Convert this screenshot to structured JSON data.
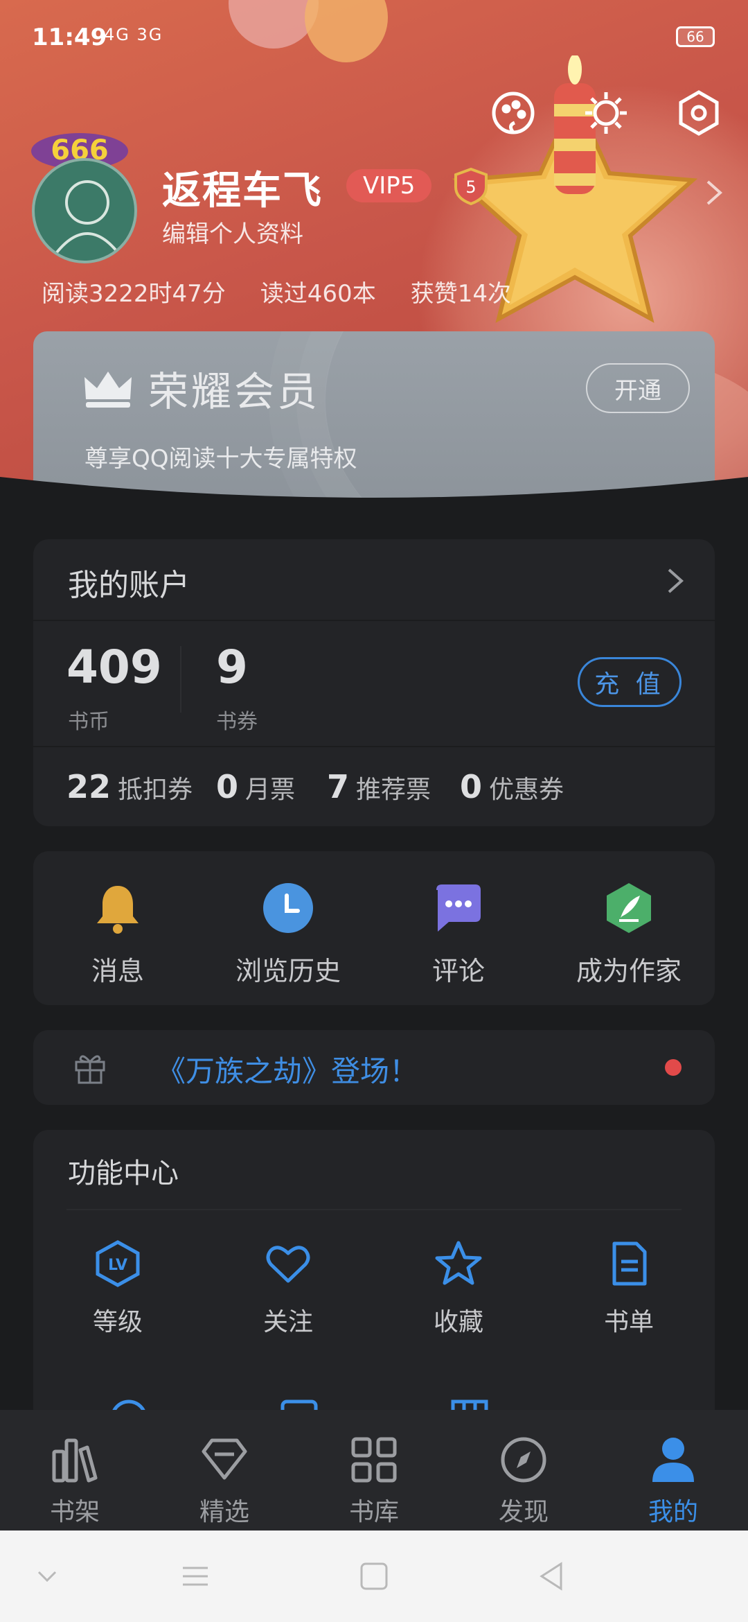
{
  "status_bar": {
    "time": "11:49",
    "network": "4G 3G",
    "battery": "66"
  },
  "profile": {
    "name": "返程车飞",
    "vip": "VIP5",
    "level": "5",
    "edit_label": "编辑个人资料",
    "stats": [
      "阅读3222时47分",
      "读过460本",
      "获赞14次"
    ]
  },
  "member": {
    "title": "荣耀会员",
    "subtitle": "尊享QQ阅读十大专属特权",
    "button": "开通"
  },
  "account": {
    "title": "我的账户",
    "coins": "409",
    "coins_label": "书币",
    "vouchers": "9",
    "vouchers_label": "书券",
    "recharge": "充 值",
    "tickets": [
      {
        "num": "22",
        "label": "抵扣券"
      },
      {
        "num": "0",
        "label": "月票"
      },
      {
        "num": "7",
        "label": "推荐票"
      },
      {
        "num": "0",
        "label": "优惠券"
      }
    ]
  },
  "quick": [
    {
      "label": "消息",
      "icon": "bell-icon"
    },
    {
      "label": "浏览历史",
      "icon": "clock-icon"
    },
    {
      "label": "评论",
      "icon": "comment-icon"
    },
    {
      "label": "成为作家",
      "icon": "pen-icon"
    }
  ],
  "promo": {
    "text": "《万族之劫》登场！"
  },
  "functions": {
    "title": "功能中心",
    "items": [
      {
        "label": "等级",
        "icon": "level-icon"
      },
      {
        "label": "关注",
        "icon": "heart-icon"
      },
      {
        "label": "收藏",
        "icon": "star-icon"
      },
      {
        "label": "书单",
        "icon": "booklist-icon"
      }
    ]
  },
  "tabs": [
    {
      "label": "书架",
      "icon": "bookshelf-icon"
    },
    {
      "label": "精选",
      "icon": "diamond-icon"
    },
    {
      "label": "书库",
      "icon": "grid-icon"
    },
    {
      "label": "发现",
      "icon": "compass-icon"
    },
    {
      "label": "我的",
      "icon": "user-icon"
    }
  ],
  "colors": {
    "accent": "#3b8fe8",
    "banner": "#c9574a",
    "vip": "#e25a55",
    "card": "#232427"
  }
}
